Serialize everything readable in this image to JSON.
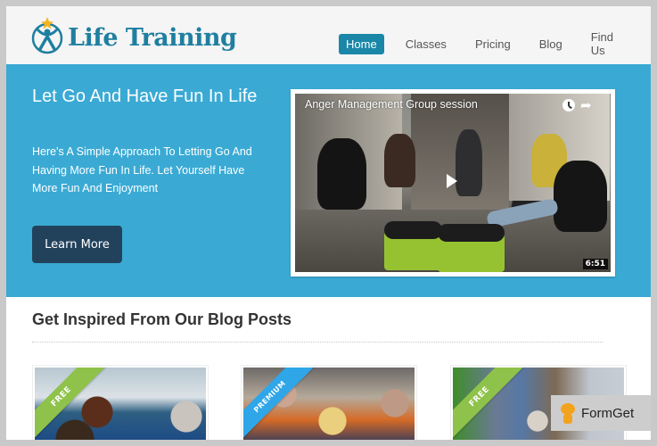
{
  "header": {
    "logo_text": "Life Training",
    "nav": [
      {
        "label": "Home",
        "active": true
      },
      {
        "label": "Classes",
        "active": false
      },
      {
        "label": "Pricing",
        "active": false
      },
      {
        "label": "Blog",
        "active": false
      },
      {
        "label": "Find Us",
        "active": false
      }
    ]
  },
  "hero": {
    "title": "Let Go And Have Fun In Life",
    "subtitle": "Here's A Simple Approach To Letting Go And Having More Fun In Life. Let Yourself Have More Fun And Enjoyment",
    "cta_label": "Learn More",
    "video": {
      "title": "Anger Management Group session",
      "duration": "6:51",
      "watch_later_icon": "clock-icon",
      "share_icon": "share-arrow-icon",
      "share_glyph": "➦"
    }
  },
  "blog": {
    "heading": "Get Inspired From Our Blog Posts",
    "cards": [
      {
        "ribbon": "FREE"
      },
      {
        "ribbon": "PREMIUM"
      },
      {
        "ribbon": "FREE"
      }
    ]
  },
  "watermark": {
    "text": "FormGet"
  },
  "colors": {
    "brand": "#1f7fa0",
    "hero_bg": "#3aaad4",
    "cta_bg": "#22425c",
    "nav_active": "#1a87a8",
    "ribbon_free": "#8fc24a",
    "ribbon_premium": "#2fa6e8"
  }
}
